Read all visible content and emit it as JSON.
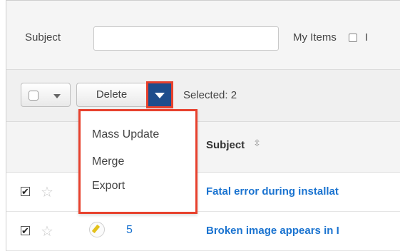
{
  "filter": {
    "subject_label": "Subject",
    "subject_value": "",
    "my_items_label": "My Items",
    "cut_off_label": "I"
  },
  "actions": {
    "delete_label": "Delete",
    "selected_label": "Selected: 2"
  },
  "menu": {
    "items": [
      "Mass Update",
      "Merge",
      "Export"
    ]
  },
  "table": {
    "columns": {
      "subject": "Subject",
      "sort_icon": "⇳"
    },
    "rows": [
      {
        "checked": true,
        "number": "",
        "subject": "Fatal error during installat"
      },
      {
        "checked": true,
        "number": "5",
        "subject": "Broken image appears in I"
      }
    ]
  },
  "icons": {
    "checkmark": "✔",
    "star": "☆"
  },
  "colors": {
    "highlight": "#e7412d",
    "dropdown_button": "#1e4d8c",
    "link": "#1a73d0"
  }
}
